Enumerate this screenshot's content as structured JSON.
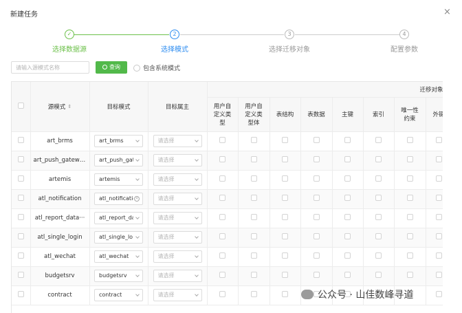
{
  "dialog": {
    "title": "新建任务",
    "close": "×"
  },
  "steps": [
    {
      "num": "✓",
      "label": "选择数据源",
      "state": "done"
    },
    {
      "num": "2",
      "label": "选择模式",
      "state": "active"
    },
    {
      "num": "3",
      "label": "选择迁移对象",
      "state": "pending"
    },
    {
      "num": "4",
      "label": "配置参数",
      "state": "pending"
    }
  ],
  "filter": {
    "search_placeholder": "请输入源模式名称",
    "query_label": "查询",
    "include_system_label": "包含系统模式"
  },
  "table": {
    "group_header": "迁移对象",
    "headers": {
      "source": "源模式",
      "target": "目标模式",
      "owner": "目标属主",
      "cols": [
        "用户自定义类型",
        "用户自定义类型体",
        "表结构",
        "表数据",
        "主键",
        "索引",
        "唯一性约束",
        "外键"
      ]
    },
    "header_display": {
      "udt": [
        "用户自",
        "定义类",
        "型"
      ],
      "udtb": [
        "用户自",
        "定义类",
        "型体"
      ],
      "uniq": [
        "唯一性",
        "约束"
      ]
    },
    "owner_placeholder": "请选择",
    "rows": [
      {
        "source": "art_brms",
        "target": "art_brms",
        "target_icon": "arrow"
      },
      {
        "source": "art_push_gateway",
        "target": "art_push_gat",
        "target_icon": "arrow"
      },
      {
        "source": "artemis",
        "target": "artemis",
        "target_icon": "arrow"
      },
      {
        "source": "atl_notification",
        "target": "atl_notificatio",
        "target_icon": "clear"
      },
      {
        "source": "atl_report_data···",
        "target": "atl_report_da",
        "target_icon": "arrow"
      },
      {
        "source": "atl_single_login",
        "target": "atl_single_lo",
        "target_icon": "arrow"
      },
      {
        "source": "atl_wechat",
        "target": "atl_wechat",
        "target_icon": "arrow"
      },
      {
        "source": "budgetsrv",
        "target": "budgetsrv",
        "target_icon": "arrow"
      },
      {
        "source": "contract",
        "target": "contract",
        "target_icon": "arrow"
      }
    ]
  },
  "watermark": "公众号 · 山佳数峰寻道",
  "colors": {
    "done": "#6cc04a",
    "active": "#2d8cf0",
    "query_button": "#52b94a"
  }
}
